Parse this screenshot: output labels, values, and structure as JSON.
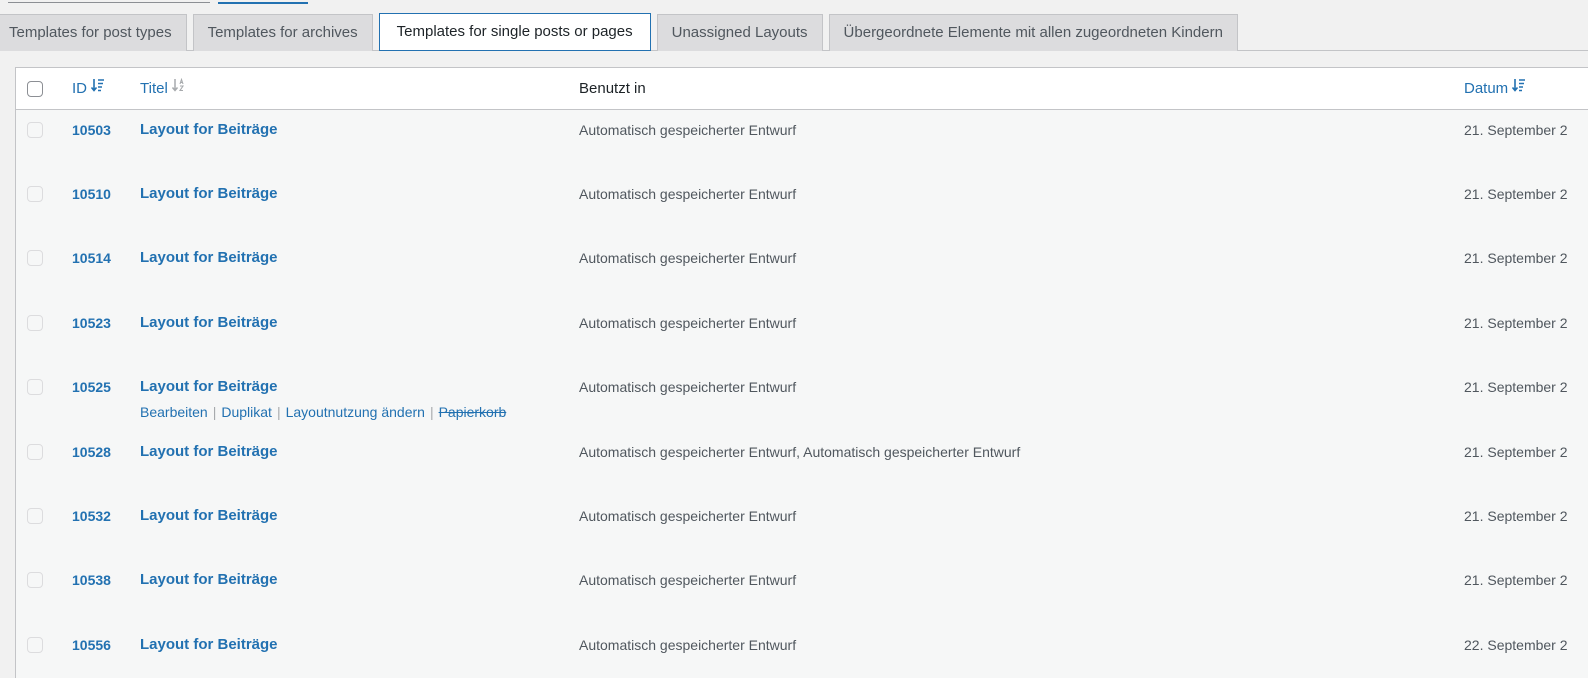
{
  "tabs": [
    {
      "label": "Templates for post types",
      "active": false
    },
    {
      "label": "Templates for archives",
      "active": false
    },
    {
      "label": "Templates for single posts or pages",
      "active": true
    },
    {
      "label": "Unassigned Layouts",
      "active": false
    },
    {
      "label": "Übergeordnete Elemente mit allen zugeordneten Kindern",
      "active": false
    }
  ],
  "table": {
    "columns": {
      "id": "ID",
      "title": "Titel",
      "used_in": "Benutzt in",
      "date": "Datum"
    },
    "rows": [
      {
        "id": "10503",
        "title": "Layout for Beiträge",
        "used_in": "Automatisch gespeicherter Entwurf",
        "date": "21. September 2"
      },
      {
        "id": "10510",
        "title": "Layout for Beiträge",
        "used_in": "Automatisch gespeicherter Entwurf",
        "date": "21. September 2"
      },
      {
        "id": "10514",
        "title": "Layout for Beiträge",
        "used_in": "Automatisch gespeicherter Entwurf",
        "date": "21. September 2"
      },
      {
        "id": "10523",
        "title": "Layout for Beiträge",
        "used_in": "Automatisch gespeicherter Entwurf",
        "date": "21. September 2"
      },
      {
        "id": "10525",
        "title": "Layout for Beiträge",
        "used_in": "Automatisch gespeicherter Entwurf",
        "date": "21. September 2"
      },
      {
        "id": "10528",
        "title": "Layout for Beiträge",
        "used_in": "Automatisch gespeicherter Entwurf, Automatisch gespeicherter Entwurf",
        "date": "21. September 2"
      },
      {
        "id": "10532",
        "title": "Layout for Beiträge",
        "used_in": "Automatisch gespeicherter Entwurf",
        "date": "21. September 2"
      },
      {
        "id": "10538",
        "title": "Layout for Beiträge",
        "used_in": "Automatisch gespeicherter Entwurf",
        "date": "21. September 2"
      },
      {
        "id": "10556",
        "title": "Layout for Beiträge",
        "used_in": "Automatisch gespeicherter Entwurf",
        "date": "22. September 2"
      }
    ],
    "row_actions": {
      "edit": "Bearbeiten",
      "duplicate": "Duplikat",
      "change_usage": "Layoutnutzung ändern",
      "trash": "Papierkorb"
    }
  },
  "icons": {
    "sort_desc": "sort-desc-icon",
    "sort_alpha": "sort-alpha-icon"
  },
  "colors": {
    "link": "#2271b1",
    "text": "#50575e",
    "border": "#c3c4c7"
  }
}
